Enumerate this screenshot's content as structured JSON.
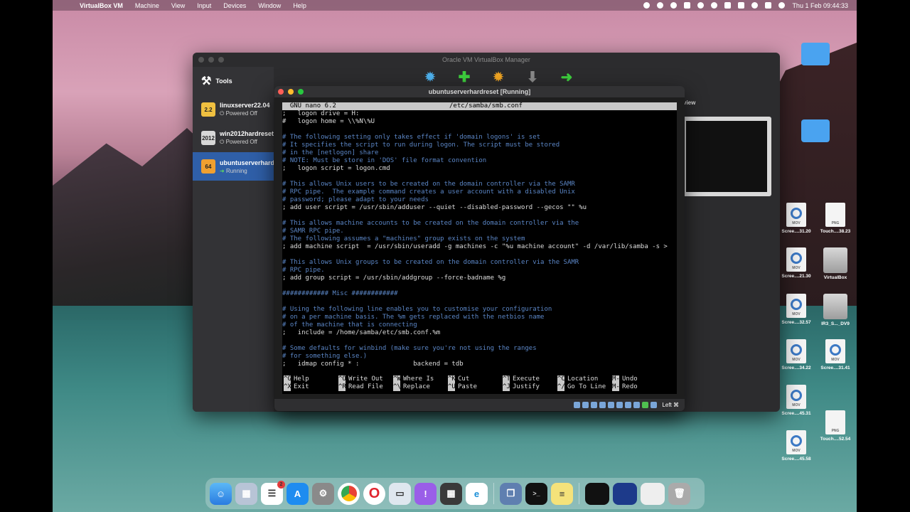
{
  "menubar": {
    "app_name": "VirtualBox VM",
    "items": [
      "Machine",
      "View",
      "Input",
      "Devices",
      "Window",
      "Help"
    ],
    "datetime": "Thu 1 Feb  09:44:33"
  },
  "manager": {
    "title": "Oracle VM VirtualBox Manager",
    "tools_label": "Tools",
    "vms": [
      {
        "name": "linuxserver22.04",
        "state": "Powered Off",
        "badge": "2.2"
      },
      {
        "name": "win2012hardreset",
        "state": "Powered Off",
        "badge": "2012"
      },
      {
        "name": "ubuntuserverhardreset",
        "state": "Running",
        "badge": "64"
      }
    ],
    "preview_label": "view"
  },
  "vm_window": {
    "title": "ubuntuserverhardreset [Running]",
    "nano_version": "  GNU nano 6.2",
    "file_path": "/etc/samba/smb.conf",
    "lines": [
      {
        "t": ";   logon drive = H:",
        "c": false
      },
      {
        "t": "#   logon home = \\\\%N\\%U",
        "c": false
      },
      {
        "t": "",
        "c": false
      },
      {
        "t": "# The following setting only takes effect if 'domain logons' is set",
        "c": true
      },
      {
        "t": "# It specifies the script to run during logon. The script must be stored",
        "c": true
      },
      {
        "t": "# in the [netlogon] share",
        "c": true
      },
      {
        "t": "# NOTE: Must be store in 'DOS' file format convention",
        "c": true
      },
      {
        "t": ";   logon script = logon.cmd",
        "c": false
      },
      {
        "t": "",
        "c": false
      },
      {
        "t": "# This allows Unix users to be created on the domain controller via the SAMR",
        "c": true
      },
      {
        "t": "# RPC pipe.  The example command creates a user account with a disabled Unix",
        "c": true
      },
      {
        "t": "# password; please adapt to your needs",
        "c": true
      },
      {
        "t": "; add user script = /usr/sbin/adduser --quiet --disabled-password --gecos \"\" %u",
        "c": false
      },
      {
        "t": "",
        "c": false
      },
      {
        "t": "# This allows machine accounts to be created on the domain controller via the",
        "c": true
      },
      {
        "t": "# SAMR RPC pipe.",
        "c": true
      },
      {
        "t": "# The following assumes a \"machines\" group exists on the system",
        "c": true
      },
      {
        "t": "; add machine script  = /usr/sbin/useradd -g machines -c \"%u machine account\" -d /var/lib/samba -s >",
        "c": false
      },
      {
        "t": "",
        "c": false
      },
      {
        "t": "# This allows Unix groups to be created on the domain controller via the SAMR",
        "c": true
      },
      {
        "t": "# RPC pipe.",
        "c": true
      },
      {
        "t": "; add group script = /usr/sbin/addgroup --force-badname %g",
        "c": false
      },
      {
        "t": "",
        "c": false
      },
      {
        "t": "############ Misc ############",
        "c": true
      },
      {
        "t": "",
        "c": false
      },
      {
        "t": "# Using the following line enables you to customise your configuration",
        "c": true
      },
      {
        "t": "# on a per machine basis. The %m gets replaced with the netbios name",
        "c": true
      },
      {
        "t": "# of the machine that is connecting",
        "c": true
      },
      {
        "t": ";   include = /home/samba/etc/smb.conf.%m",
        "c": false
      },
      {
        "t": "",
        "c": false
      },
      {
        "t": "# Some defaults for winbind (make sure you're not using the ranges",
        "c": true
      },
      {
        "t": "# for something else.)",
        "c": true
      },
      {
        "t": ";   idmap config * :              backend = tdb",
        "c": false
      }
    ],
    "shortcuts": [
      {
        "key": "^G",
        "label": "Help"
      },
      {
        "key": "^O",
        "label": "Write Out"
      },
      {
        "key": "^W",
        "label": "Where Is"
      },
      {
        "key": "^K",
        "label": "Cut"
      },
      {
        "key": "^T",
        "label": "Execute"
      },
      {
        "key": "^C",
        "label": "Location"
      },
      {
        "key": "M-U",
        "label": "Undo"
      },
      {
        "key": "^X",
        "label": "Exit"
      },
      {
        "key": "^R",
        "label": "Read File"
      },
      {
        "key": "^\\",
        "label": "Replace"
      },
      {
        "key": "^U",
        "label": "Paste"
      },
      {
        "key": "^J",
        "label": "Justify"
      },
      {
        "key": "^/",
        "label": "Go To Line"
      },
      {
        "key": "M-E",
        "label": "Redo"
      }
    ],
    "host_key": "Left ⌘"
  },
  "desktop_icons": [
    {
      "label": "Scree....31.20",
      "kind": "MOV"
    },
    {
      "label": "Touch....38.23",
      "kind": "PNG"
    },
    {
      "label": "Scree....21.30",
      "kind": "MOV"
    },
    {
      "label": "VirtualBox",
      "kind": "drive"
    },
    {
      "label": "Scree....32.57",
      "kind": "MOV"
    },
    {
      "label": "IR3_S..._DV9",
      "kind": "drive"
    },
    {
      "label": "Scree....34.22",
      "kind": "MOV"
    },
    {
      "label": "Scree....31.41",
      "kind": "MOV"
    },
    {
      "label": "Scree....45.31",
      "kind": "MOV"
    },
    {
      "label": "Touch....52.54",
      "kind": "PNG"
    },
    {
      "label": "Scree....45.58",
      "kind": "MOV"
    }
  ],
  "dock": {
    "reminders_badge": "2"
  }
}
